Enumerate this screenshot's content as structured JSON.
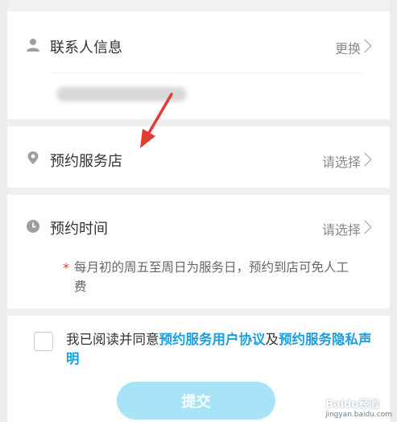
{
  "contact": {
    "title": "联系人信息",
    "action": "更换"
  },
  "store": {
    "title": "预约服务店",
    "action": "请选择"
  },
  "time": {
    "title": "预约时间",
    "action": "请选择",
    "note": "每月初的周五至周日为服务日，预约到店可免人工费"
  },
  "agreement": {
    "prefix": "我已阅读并同意",
    "link_user": "预约服务用户协议",
    "and": "及",
    "link_privacy": "预约服务隐私声明"
  },
  "submit_label": "提交",
  "watermark": {
    "brand": "Baidu经验",
    "url": "jingyan.baidu.com"
  },
  "icons": {
    "contact": "person-icon",
    "store": "location-pin-icon",
    "time": "clock-icon",
    "arrow": "red-arrow-annotation"
  },
  "colors": {
    "link": "#1a9fe0",
    "submit_bg": "#a9e3f7",
    "note_star": "#e53935",
    "annotation_arrow": "#e53935"
  }
}
